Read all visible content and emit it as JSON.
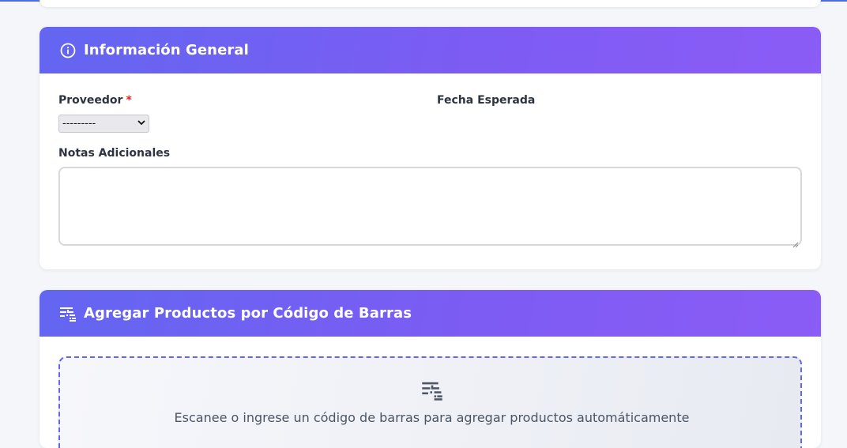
{
  "general": {
    "title": "Información General",
    "icon": "info-circle-icon",
    "supplier_label": "Proveedor",
    "required_mark": "*",
    "supplier_value": "---------",
    "expected_date_label": "Fecha Esperada",
    "notes_label": "Notas Adicionales",
    "notes_value": ""
  },
  "barcode": {
    "title": "Agregar Productos por Código de Barras",
    "icon": "barcode-scan-icon",
    "instruction": "Escanee o ingrese un código de barras para agregar productos automáticamente"
  },
  "colors": {
    "header_gradient_start": "#6366f1",
    "header_gradient_end": "#8b5cf6",
    "required": "#dc2626",
    "dashed_border": "#6366f1"
  }
}
